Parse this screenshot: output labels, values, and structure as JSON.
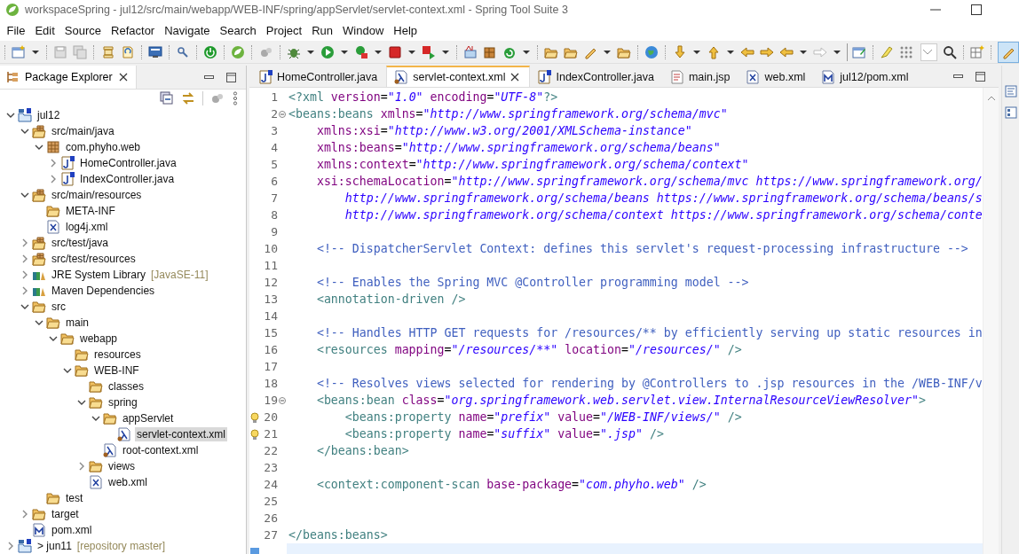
{
  "window": {
    "title": "workspaceSpring - jul12/src/main/webapp/WEB-INF/spring/appServlet/servlet-context.xml - Spring Tool Suite 3"
  },
  "menu": [
    "File",
    "Edit",
    "Source",
    "Refactor",
    "Navigate",
    "Search",
    "Project",
    "Run",
    "Window",
    "Help"
  ],
  "package_explorer": {
    "title": "Package Explorer",
    "tree": [
      {
        "label": "jul12",
        "kind": "project",
        "expanded": true,
        "selected": false,
        "children": [
          {
            "label": "src/main/java",
            "kind": "source-folder",
            "expanded": true,
            "selected": false,
            "children": [
              {
                "label": "com.phyho.web",
                "kind": "package",
                "expanded": true,
                "selected": false,
                "children": [
                  {
                    "label": "HomeController.java",
                    "kind": "java",
                    "expanded": false,
                    "selected": false
                  },
                  {
                    "label": "IndexController.java",
                    "kind": "java",
                    "expanded": false,
                    "selected": false
                  }
                ]
              }
            ]
          },
          {
            "label": "src/main/resources",
            "kind": "source-folder",
            "expanded": true,
            "selected": false,
            "children": [
              {
                "label": "META-INF",
                "kind": "folder",
                "selected": false
              },
              {
                "label": "log4j.xml",
                "kind": "xml",
                "selected": false
              }
            ]
          },
          {
            "label": "src/test/java",
            "kind": "source-folder",
            "expanded": false,
            "selected": false
          },
          {
            "label": "src/test/resources",
            "kind": "source-folder",
            "expanded": false,
            "selected": false
          },
          {
            "label": "JRE System Library",
            "decoration": "[JavaSE-11]",
            "kind": "library",
            "expanded": false,
            "selected": false
          },
          {
            "label": "Maven Dependencies",
            "kind": "library",
            "expanded": false,
            "selected": false
          },
          {
            "label": "src",
            "kind": "folder",
            "expanded": true,
            "selected": false,
            "children": [
              {
                "label": "main",
                "kind": "folder",
                "expanded": true,
                "selected": false,
                "children": [
                  {
                    "label": "webapp",
                    "kind": "folder",
                    "expanded": true,
                    "selected": false,
                    "children": [
                      {
                        "label": "resources",
                        "kind": "folder",
                        "selected": false
                      },
                      {
                        "label": "WEB-INF",
                        "kind": "folder",
                        "expanded": true,
                        "selected": false,
                        "children": [
                          {
                            "label": "classes",
                            "kind": "folder",
                            "selected": false
                          },
                          {
                            "label": "spring",
                            "kind": "folder",
                            "expanded": true,
                            "selected": false,
                            "children": [
                              {
                                "label": "appServlet",
                                "kind": "folder",
                                "expanded": true,
                                "selected": false,
                                "children": [
                                  {
                                    "label": "servlet-context.xml",
                                    "kind": "spring-xml",
                                    "selected": true
                                  }
                                ]
                              },
                              {
                                "label": "root-context.xml",
                                "kind": "spring-xml",
                                "selected": false
                              }
                            ]
                          },
                          {
                            "label": "views",
                            "kind": "folder",
                            "expanded": false,
                            "selected": false
                          },
                          {
                            "label": "web.xml",
                            "kind": "xml",
                            "selected": false
                          }
                        ]
                      }
                    ]
                  }
                ]
              },
              {
                "label": "test",
                "kind": "folder",
                "selected": false
              }
            ]
          },
          {
            "label": "target",
            "kind": "folder",
            "expanded": false,
            "selected": false
          },
          {
            "label": "pom.xml",
            "kind": "maven",
            "selected": false
          }
        ]
      },
      {
        "label": "> jun11",
        "decoration": "[repository master]",
        "kind": "project",
        "expanded": false,
        "selected": false
      }
    ]
  },
  "editor": {
    "tabs": [
      {
        "label": "HomeController.java",
        "kind": "java",
        "selected": false
      },
      {
        "label": "servlet-context.xml",
        "kind": "spring-xml",
        "selected": true
      },
      {
        "label": "IndexController.java",
        "kind": "java",
        "selected": false
      },
      {
        "label": "main.jsp",
        "kind": "jsp",
        "selected": false
      },
      {
        "label": "web.xml",
        "kind": "xml",
        "selected": false
      },
      {
        "label": "jul12/pom.xml",
        "kind": "maven",
        "selected": false
      }
    ],
    "lines": [
      {
        "number": "1",
        "fold": false,
        "warning": false,
        "current": false,
        "tokens": [
          {
            "kind": "tag",
            "text": "<?xml"
          },
          {
            "kind": "attr",
            "text": " version"
          },
          {
            "kind": "plain",
            "text": "="
          },
          {
            "kind": "string",
            "text": "\"1.0\""
          },
          {
            "kind": "attr",
            "text": " encoding"
          },
          {
            "kind": "plain",
            "text": "="
          },
          {
            "kind": "string",
            "text": "\"UTF-8\""
          },
          {
            "kind": "tag",
            "text": "?>"
          }
        ]
      },
      {
        "number": "2",
        "fold": true,
        "warning": false,
        "current": false,
        "tokens": [
          {
            "kind": "tag",
            "text": "<beans:beans"
          },
          {
            "kind": "attr",
            "text": " xmlns"
          },
          {
            "kind": "plain",
            "text": "="
          },
          {
            "kind": "string",
            "text": "\"http://www.springframework.org/schema/mvc\""
          }
        ]
      },
      {
        "number": "3",
        "fold": false,
        "warning": false,
        "current": false,
        "tokens": [
          {
            "kind": "attr",
            "text": "    xmlns:xsi"
          },
          {
            "kind": "plain",
            "text": "="
          },
          {
            "kind": "string",
            "text": "\"http://www.w3.org/2001/XMLSchema-instance\""
          }
        ]
      },
      {
        "number": "4",
        "fold": false,
        "warning": false,
        "current": false,
        "tokens": [
          {
            "kind": "attr",
            "text": "    xmlns:beans"
          },
          {
            "kind": "plain",
            "text": "="
          },
          {
            "kind": "string",
            "text": "\"http://www.springframework.org/schema/beans\""
          }
        ]
      },
      {
        "number": "5",
        "fold": false,
        "warning": false,
        "current": false,
        "tokens": [
          {
            "kind": "attr",
            "text": "    xmlns:context"
          },
          {
            "kind": "plain",
            "text": "="
          },
          {
            "kind": "string",
            "text": "\"http://www.springframework.org/schema/context\""
          }
        ]
      },
      {
        "number": "6",
        "fold": false,
        "warning": false,
        "current": false,
        "tokens": [
          {
            "kind": "attr",
            "text": "    xsi:schemaLocation"
          },
          {
            "kind": "plain",
            "text": "="
          },
          {
            "kind": "string",
            "text": "\"http://www.springframework.org/schema/mvc https://www.springframework.org/"
          }
        ]
      },
      {
        "number": "7",
        "fold": false,
        "warning": false,
        "current": false,
        "tokens": [
          {
            "kind": "string",
            "text": "        http://www.springframework.org/schema/beans https://www.springframework.org/schema/beans/s"
          }
        ]
      },
      {
        "number": "8",
        "fold": false,
        "warning": false,
        "current": false,
        "tokens": [
          {
            "kind": "string",
            "text": "        http://www.springframework.org/schema/context https://www.springframework.org/schema/conte"
          }
        ]
      },
      {
        "number": "9",
        "fold": false,
        "warning": false,
        "current": false
      },
      {
        "number": "10",
        "fold": false,
        "warning": false,
        "current": false,
        "tokens": [
          {
            "kind": "comment",
            "text": "    <!-- DispatcherServlet Context: defines this servlet's request-processing infrastructure -->"
          }
        ]
      },
      {
        "number": "11",
        "fold": false,
        "warning": false,
        "current": false
      },
      {
        "number": "12",
        "fold": false,
        "warning": false,
        "current": false,
        "tokens": [
          {
            "kind": "comment",
            "text": "    <!-- Enables the Spring MVC @Controller programming model -->"
          }
        ]
      },
      {
        "number": "13",
        "fold": false,
        "warning": false,
        "current": false,
        "tokens": [
          {
            "kind": "tag",
            "text": "    <annotation-driven />"
          }
        ]
      },
      {
        "number": "14",
        "fold": false,
        "warning": false,
        "current": false
      },
      {
        "number": "15",
        "fold": false,
        "warning": false,
        "current": false,
        "tokens": [
          {
            "kind": "comment",
            "text": "    <!-- Handles HTTP GET requests for /resources/** by efficiently serving up static resources in"
          }
        ]
      },
      {
        "number": "16",
        "fold": false,
        "warning": false,
        "current": false,
        "tokens": [
          {
            "kind": "tag",
            "text": "    <resources"
          },
          {
            "kind": "attr",
            "text": " mapping"
          },
          {
            "kind": "plain",
            "text": "="
          },
          {
            "kind": "string",
            "text": "\"/resources/**\""
          },
          {
            "kind": "attr",
            "text": " location"
          },
          {
            "kind": "plain",
            "text": "="
          },
          {
            "kind": "string",
            "text": "\"/resources/\""
          },
          {
            "kind": "tag",
            "text": " />"
          }
        ]
      },
      {
        "number": "17",
        "fold": false,
        "warning": false,
        "current": false
      },
      {
        "number": "18",
        "fold": false,
        "warning": false,
        "current": false,
        "tokens": [
          {
            "kind": "comment",
            "text": "    <!-- Resolves views selected for rendering by @Controllers to .jsp resources in the /WEB-INF/v"
          }
        ]
      },
      {
        "number": "19",
        "fold": true,
        "warning": false,
        "current": false,
        "tokens": [
          {
            "kind": "tag",
            "text": "    <beans:bean"
          },
          {
            "kind": "attr",
            "text": " class"
          },
          {
            "kind": "plain",
            "text": "="
          },
          {
            "kind": "string",
            "text": "\"org.springframework.web.servlet.view.InternalResourceViewResolver\""
          },
          {
            "kind": "tag",
            "text": ">"
          }
        ]
      },
      {
        "number": "20",
        "fold": false,
        "warning": true,
        "current": false,
        "tokens": [
          {
            "kind": "tag",
            "text": "        <beans:property"
          },
          {
            "kind": "attr",
            "text": " name"
          },
          {
            "kind": "plain",
            "text": "="
          },
          {
            "kind": "string",
            "text": "\"prefix\""
          },
          {
            "kind": "attr",
            "text": " value"
          },
          {
            "kind": "plain",
            "text": "="
          },
          {
            "kind": "string",
            "text": "\"/WEB-INF/views/\""
          },
          {
            "kind": "tag",
            "text": " />"
          }
        ]
      },
      {
        "number": "21",
        "fold": false,
        "warning": true,
        "current": false,
        "tokens": [
          {
            "kind": "tag",
            "text": "        <beans:property"
          },
          {
            "kind": "attr",
            "text": " name"
          },
          {
            "kind": "plain",
            "text": "="
          },
          {
            "kind": "string",
            "text": "\"suffix\""
          },
          {
            "kind": "attr",
            "text": " value"
          },
          {
            "kind": "plain",
            "text": "="
          },
          {
            "kind": "string",
            "text": "\".jsp\""
          },
          {
            "kind": "tag",
            "text": " />"
          }
        ]
      },
      {
        "number": "22",
        "fold": false,
        "warning": false,
        "current": false,
        "tokens": [
          {
            "kind": "tag",
            "text": "    </beans:bean>"
          }
        ]
      },
      {
        "number": "23",
        "fold": false,
        "warning": false,
        "current": false
      },
      {
        "number": "24",
        "fold": false,
        "warning": false,
        "current": false,
        "tokens": [
          {
            "kind": "tag",
            "text": "    <context:component-scan"
          },
          {
            "kind": "attr",
            "text": " base-package"
          },
          {
            "kind": "plain",
            "text": "="
          },
          {
            "kind": "string",
            "text": "\"com.phyho.web\""
          },
          {
            "kind": "tag",
            "text": " />"
          }
        ]
      },
      {
        "number": "25",
        "fold": false,
        "warning": false,
        "current": false
      },
      {
        "number": "26",
        "fold": false,
        "warning": false,
        "current": false
      },
      {
        "number": "27",
        "fold": false,
        "warning": false,
        "current": false,
        "tokens": [
          {
            "kind": "tag",
            "text": "</beans:beans>"
          }
        ]
      },
      {
        "fold": false,
        "warning": false,
        "current": true
      }
    ]
  }
}
